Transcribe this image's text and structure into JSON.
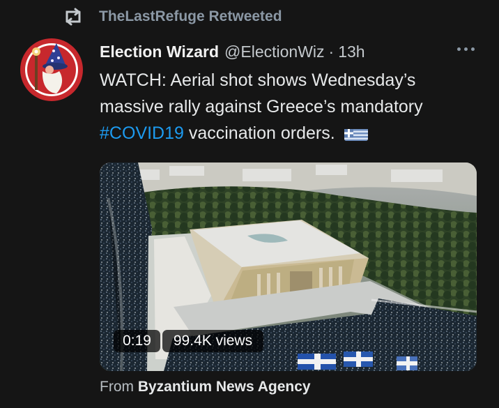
{
  "retweet_header": {
    "icon": "retweet-icon",
    "text": "TheLastRefuge Retweeted"
  },
  "tweet": {
    "author": {
      "display_name": "Election Wizard",
      "handle": "@ElectionWiz",
      "separator": "·",
      "time": "13h",
      "avatar_icon": "wizard-avatar",
      "avatar_colors": {
        "ring": "#c7282d",
        "hat": "#2f3f95",
        "beard": "#f4f2ea"
      }
    },
    "more_icon": "more-dots-icon",
    "text": {
      "part_1": "WATCH: Aerial shot shows Wednesday’s",
      "part_2": "massive rally against Greece’s mandatory",
      "hashtag": "#COVID19",
      "part_3": " vaccination orders. ",
      "flag_icon": "greece-flag-icon"
    },
    "media": {
      "image_semantics": "aerial-rally-video-thumbnail",
      "duration": "0:19",
      "views": "99.4K views"
    },
    "source": {
      "prefix": "From ",
      "name": "Byzantium News Agency"
    }
  },
  "colors": {
    "background": "#151515",
    "primary_text": "#e7e9ea",
    "secondary_text": "#8b98a5",
    "link": "#1d9bf0"
  }
}
